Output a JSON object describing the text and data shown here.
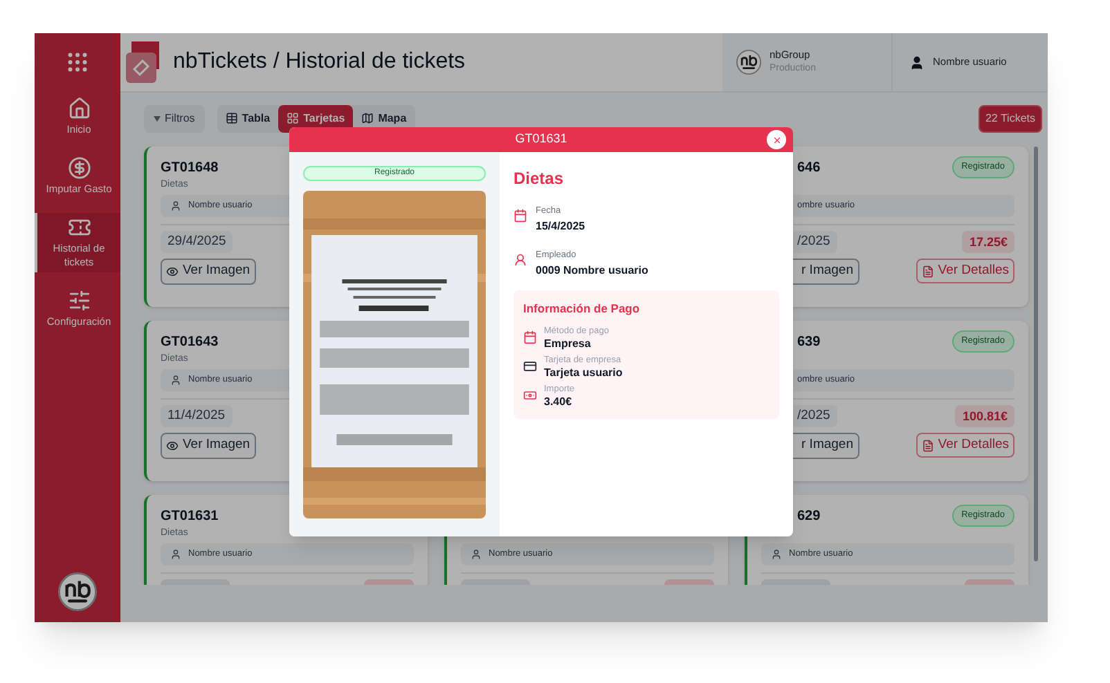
{
  "sidebar": {
    "items": [
      {
        "label": "Inicio",
        "selected": false
      },
      {
        "label": "Imputar Gasto",
        "selected": false
      },
      {
        "label": "Historial de tickets",
        "selected": true
      },
      {
        "label": "Configuración",
        "selected": false
      }
    ]
  },
  "header": {
    "title": "nbTickets / Historial de tickets",
    "org": {
      "name": "nbGroup",
      "env": "Production"
    },
    "user": "Nombre usuario"
  },
  "toolbar": {
    "filter": "Filtros",
    "views": [
      {
        "label": "Tabla",
        "selected": false
      },
      {
        "label": "Tarjetas",
        "selected": true
      },
      {
        "label": "Mapa",
        "selected": false
      }
    ],
    "count": "22 Tickets"
  },
  "columns": [
    {
      "cards": [
        {
          "title": "GT01648",
          "category": "Dietas",
          "user": "Nombre usuario",
          "date": "29/4/2025",
          "image_button": "Ver Imagen"
        },
        {
          "title": "GT01643",
          "category": "Dietas",
          "user": "Nombre usuario",
          "date": "11/4/2025",
          "image_button": "Ver Imagen"
        },
        {
          "title": "GT01631",
          "category": "Dietas",
          "user": "Nombre usuario"
        }
      ]
    },
    {
      "cards": [
        {
          "user": "Nombre usuario"
        }
      ]
    },
    {
      "cards": [
        {
          "title": "646",
          "status": "Registrado",
          "user": "ombre usuario",
          "date": "/2025",
          "price": "17.25€",
          "image_button": "r Imagen",
          "details": "Ver Detalles"
        },
        {
          "title": "639",
          "status": "Registrado",
          "user": "ombre usuario",
          "date": "/2025",
          "price": "100.81€",
          "image_button": "r Imagen",
          "details": "Ver Detalles"
        },
        {
          "title": "629",
          "status": "Registrado",
          "user": "Nombre usuario"
        }
      ]
    }
  ],
  "modal": {
    "title": "GT01631",
    "status": "Registrado",
    "category": "Dietas",
    "fields": [
      {
        "label": "Fecha",
        "value": "15/4/2025"
      },
      {
        "label": "Empleado",
        "value": "0009 Nombre usuario"
      }
    ],
    "payment": {
      "title": "Información de Pago",
      "fields": [
        {
          "label": "Método de pago",
          "value": "Empresa"
        },
        {
          "label": "Tarjeta de empresa",
          "value": "Tarjeta usuario"
        },
        {
          "label": "Importe",
          "value": "3.40€"
        }
      ]
    }
  }
}
